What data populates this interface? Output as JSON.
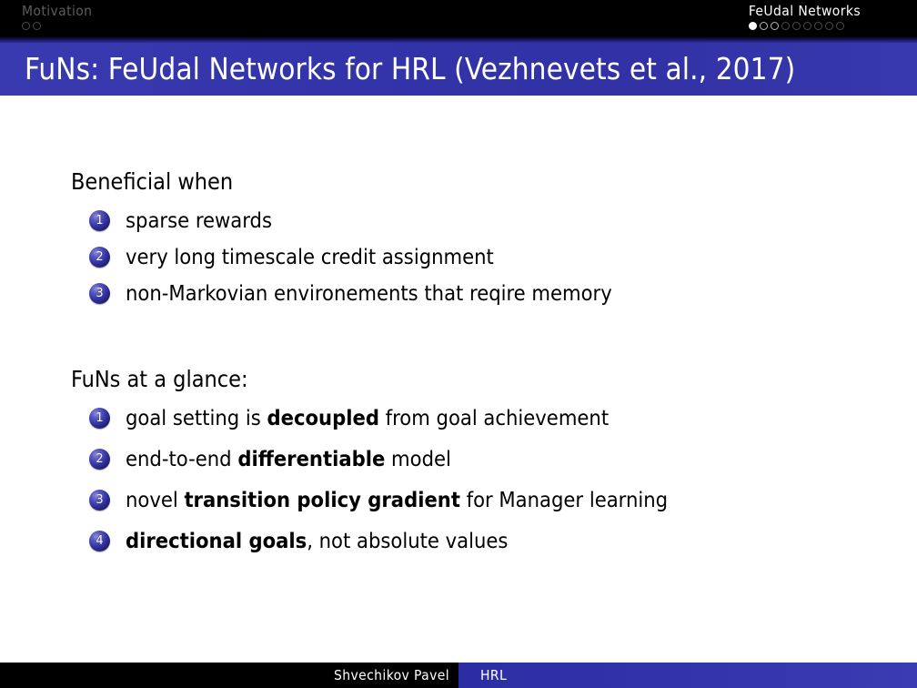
{
  "navbar": {
    "left_section": {
      "label": "Motivation",
      "dots": [
        "dim",
        "dim"
      ]
    },
    "right_section": {
      "label": "FeUdal Networks",
      "dots": [
        "filled",
        "bright",
        "bright",
        "dim",
        "dim",
        "dim",
        "dim",
        "dim",
        "dim"
      ]
    }
  },
  "title": {
    "text": "FuNs: FeUdal Networks for HRL (Vezhnevets et al., 2017)",
    "bar_color": "#3333a8"
  },
  "content": {
    "blocks": [
      {
        "heading": "Beneficial when",
        "items": [
          {
            "number": "1",
            "parts": [
              {
                "text": "sparse rewards",
                "bold": false
              }
            ]
          },
          {
            "number": "2",
            "parts": [
              {
                "text": "very long timescale credit assignment",
                "bold": false
              }
            ]
          },
          {
            "number": "3",
            "parts": [
              {
                "text": "non-Markovian environements that reqire memory",
                "bold": false
              }
            ]
          }
        ]
      },
      {
        "heading": "FuNs at a glance:",
        "items": [
          {
            "number": "1",
            "parts": [
              {
                "text": "goal setting is ",
                "bold": false
              },
              {
                "text": "decoupled",
                "bold": true
              },
              {
                "text": " from goal achievement",
                "bold": false
              }
            ]
          },
          {
            "number": "2",
            "parts": [
              {
                "text": "end-to-end ",
                "bold": false
              },
              {
                "text": "differentiable",
                "bold": true
              },
              {
                "text": " model",
                "bold": false
              }
            ]
          },
          {
            "number": "3",
            "parts": [
              {
                "text": "novel ",
                "bold": false
              },
              {
                "text": "transition policy gradient",
                "bold": true
              },
              {
                "text": " for Manager learning",
                "bold": false
              }
            ]
          },
          {
            "number": "4",
            "parts": [
              {
                "text": "directional goals",
                "bold": true
              },
              {
                "text": ", not absolute values",
                "bold": false
              }
            ]
          }
        ]
      }
    ]
  },
  "footer": {
    "author": "Shvechikov Pavel",
    "topic": "HRL",
    "left_color": "#000000",
    "right_color": "#3333a8"
  }
}
